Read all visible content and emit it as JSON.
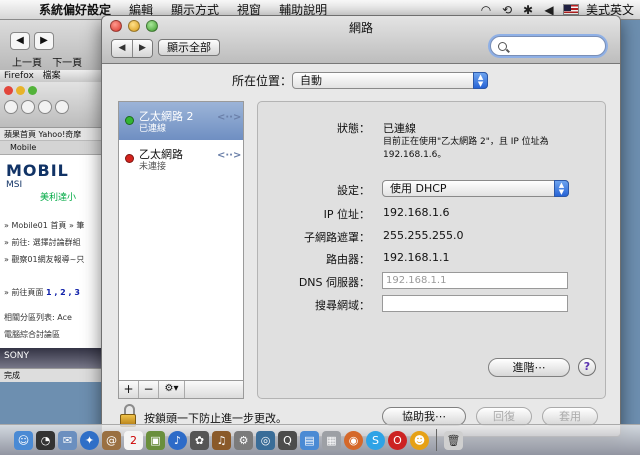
{
  "menubar": {
    "apple_icon": "apple-icon",
    "items": [
      "系統偏好設定",
      "編輯",
      "顯示方式",
      "視窗",
      "輔助說明"
    ],
    "input_label": "美式英文"
  },
  "background": {
    "back_label": "上一頁",
    "forward_label": "下一頁",
    "firefox_label": "Firefox",
    "firefox_menu": "檔案",
    "bookmarks": "蘋果首頁  Yahoo!奇摩",
    "tab": "Mobile",
    "logo": "MOBIL",
    "logo_sub": "MSI",
    "green_text": "美利達小",
    "line1": "» Mobile01 首頁 » 筆",
    "line2": "» 前往: 選擇討論群組",
    "line3": "» 觀察01網友報導~只",
    "pager_prefix": "» 前往頁面",
    "pager_pages": "1 , 2 , 3",
    "line4": "相關分區列表: Ace",
    "line5": "電腦綜合討論區",
    "sony": "SONY",
    "status": "完成"
  },
  "window": {
    "title": "網路",
    "show_all": "顯示全部",
    "search_value": "",
    "location_label": "所在位置：",
    "location_value": "自動"
  },
  "services": [
    {
      "name": "乙太網路 2",
      "status": "已連線",
      "dot_color": "#33b533",
      "selected": true
    },
    {
      "name": "乙太網路",
      "status": "未連接",
      "dot_color": "#d4231d",
      "selected": false
    }
  ],
  "service_tools": {
    "add": "+",
    "remove": "−",
    "action": "⚙▾"
  },
  "detail": {
    "status_label": "狀態：",
    "status_value": "已連線",
    "status_note": "目前正在使用\"乙太網路 2\"，且 IP 位址為 192.168.1.6。",
    "config_label": "設定：",
    "config_value": "使用 DHCP",
    "ip_label": "IP 位址：",
    "ip_value": "192.168.1.6",
    "mask_label": "子網路遮罩：",
    "mask_value": "255.255.255.0",
    "router_label": "路由器：",
    "router_value": "192.168.1.1",
    "dns_label": "DNS 伺服器：",
    "dns_value": "192.168.1.1",
    "search_domain_label": "搜尋網域：",
    "search_domain_value": "",
    "advanced_button": "進階⋯",
    "help_button": "?"
  },
  "footer": {
    "lock_text": "按鎖頭一下防止進一步更改。",
    "assist_button": "協助我⋯",
    "revert_button": "回復",
    "apply_button": "套用"
  },
  "dock_icons": [
    "finder-icon",
    "dashboard-icon",
    "mail-icon",
    "safari-icon",
    "address-book-icon",
    "ical-icon",
    "photo-icon",
    "itunes-icon",
    "iphoto-icon",
    "garageband-icon",
    "system-prefs-icon",
    "firefox-icon",
    "skype-icon",
    "trash-icon"
  ]
}
